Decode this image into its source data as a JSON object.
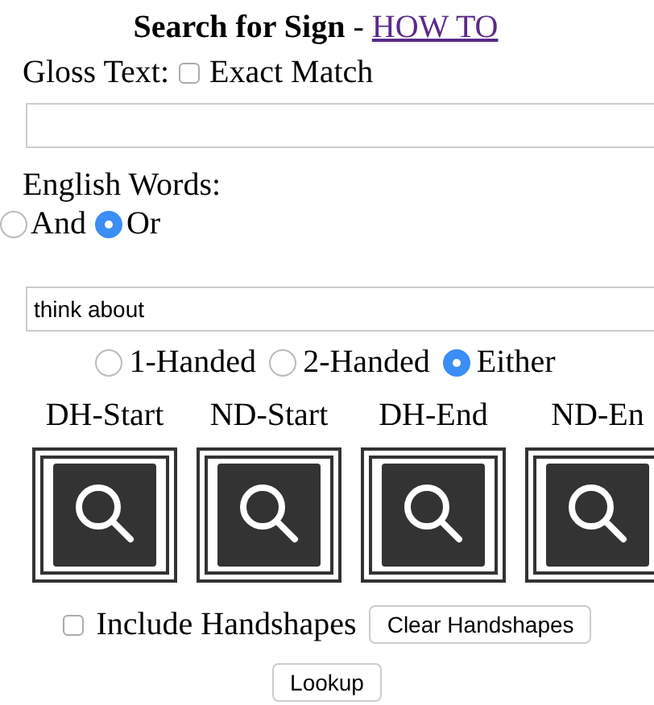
{
  "title": "Search for Sign",
  "separator": "-",
  "how_to_link": "HOW TO",
  "gloss": {
    "label": "Gloss Text:",
    "exact_match": {
      "label": "Exact Match",
      "checked": false
    }
  },
  "english_words": {
    "label": "English Words:",
    "options": [
      {
        "label": "And",
        "selected": false
      },
      {
        "label": "Or",
        "selected": true
      }
    ],
    "field": {
      "value": "think about"
    }
  },
  "hands": [
    {
      "label": "1-Handed",
      "selected": false
    },
    {
      "label": "2-Handed",
      "selected": false
    },
    {
      "label": "Either",
      "selected": true
    }
  ],
  "handshape_slots": [
    {
      "label": "DH-Start"
    },
    {
      "label": "ND-Start"
    },
    {
      "label": "DH-End"
    },
    {
      "label": "ND-En"
    }
  ],
  "include_handshapes": {
    "label": "Include Handshapes",
    "checked": false
  },
  "clear_button": "Clear Handshapes",
  "lookup_button": "Lookup"
}
